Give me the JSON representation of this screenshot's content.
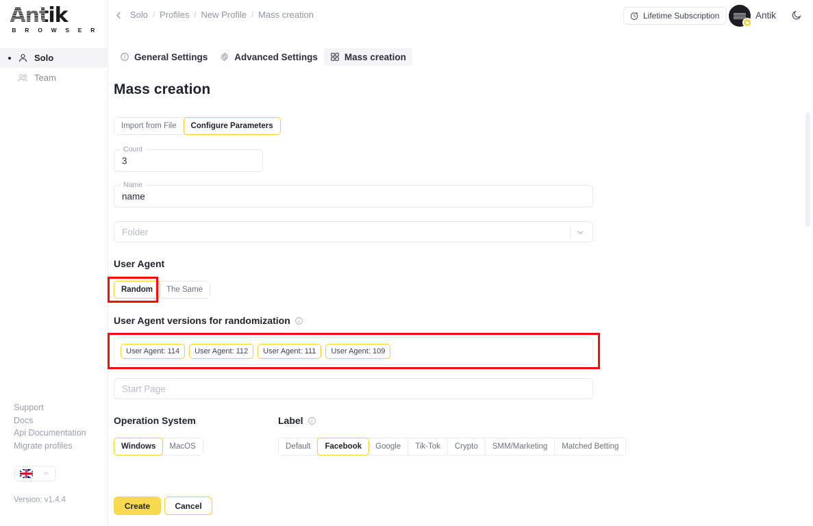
{
  "brand": {
    "name": "Antik",
    "subtitle": "B R O W S E R"
  },
  "sidebar": {
    "items": [
      {
        "label": "Solo",
        "icon": "user-icon",
        "active": true
      },
      {
        "label": "Team",
        "icon": "users-icon",
        "active": false
      }
    ],
    "links": [
      {
        "label": "Support"
      },
      {
        "label": "Docs"
      },
      {
        "label": "Api Documentation"
      },
      {
        "label": "Migrate profiles"
      }
    ],
    "language": {
      "icon": "uk-flag-icon",
      "caret": "chevron-up-icon"
    },
    "version": "Version: v1.4.4"
  },
  "topbar": {
    "back": "chevron-left-icon",
    "breadcrumb": [
      "Solo",
      "Profiles",
      "New Profile",
      "Mass creation"
    ],
    "separator": "/",
    "subscription_label": "Lifetime Subscription",
    "subscription_icon": "clock-icon",
    "user_name": "Antik",
    "avatar": "user-avatar",
    "caret_icon": "chevron-down-icon",
    "theme_icon": "moon-icon"
  },
  "tabs": [
    {
      "label": "General Settings",
      "icon": "info-circle-icon",
      "active": false
    },
    {
      "label": "Advanced Settings",
      "icon": "gear-icon",
      "active": false
    },
    {
      "label": "Mass creation",
      "icon": "grid-squares-icon",
      "active": true
    }
  ],
  "main": {
    "title": "Mass creation",
    "source_modes": [
      {
        "label": "Import from File",
        "selected": false
      },
      {
        "label": "Configure Parameters",
        "selected": true
      }
    ],
    "count_field": {
      "label": "Count",
      "value": "3"
    },
    "name_field": {
      "label": "Name",
      "value": "name"
    },
    "folder_field": {
      "placeholder": "Folder",
      "caret": "chevron-down-icon"
    },
    "user_agent": {
      "heading": "User Agent",
      "options": [
        {
          "label": "Random",
          "selected": true
        },
        {
          "label": "The Same",
          "selected": false
        }
      ]
    },
    "ua_versions": {
      "heading": "User Agent versions for randomization",
      "info_icon": "info-circle-icon",
      "chips": [
        {
          "label": "User Agent: 114",
          "selected": true
        },
        {
          "label": "User Agent: 112",
          "selected": true
        },
        {
          "label": "User Agent: 111",
          "selected": true
        },
        {
          "label": "User Agent: 109",
          "selected": true
        }
      ]
    },
    "start_page_field": {
      "placeholder": "Start Page"
    },
    "operation_system": {
      "heading": "Operation System",
      "options": [
        {
          "label": "Windows",
          "selected": true
        },
        {
          "label": "MacOS",
          "selected": false
        }
      ]
    },
    "label_section": {
      "heading": "Label",
      "info_icon": "info-circle-icon",
      "options": [
        {
          "label": "Default",
          "selected": false
        },
        {
          "label": "Facebook",
          "selected": true
        },
        {
          "label": "Google",
          "selected": false
        },
        {
          "label": "Tik-Tok",
          "selected": false
        },
        {
          "label": "Crypto",
          "selected": false
        },
        {
          "label": "SMM/Marketing",
          "selected": false
        },
        {
          "label": "Matched Betting",
          "selected": false
        }
      ]
    },
    "actions": {
      "create": "Create",
      "cancel": "Cancel"
    }
  },
  "colors": {
    "accent_yellow": "#f7cf2e",
    "create_yellow": "#f7d94f",
    "annotation_red": "#f50c0c",
    "muted_text": "#9aa0ae"
  }
}
